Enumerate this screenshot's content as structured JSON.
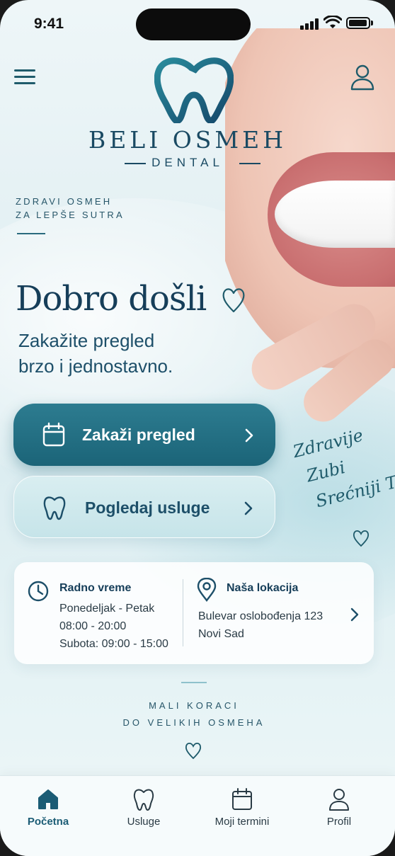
{
  "status_bar": {
    "time": "9:41"
  },
  "header": {
    "brand_name": "BELI OSMEH",
    "brand_sub": "DENTAL",
    "menu_icon": "hamburger-menu-icon",
    "profile_icon": "user-icon"
  },
  "tagline": {
    "line1": "ZDRAVI OSMEH",
    "line2": "ZA LEPŠE SUTRA"
  },
  "hero": {
    "title": "Dobro došli",
    "subtitle_line1": "Zakažite pregled",
    "subtitle_line2": "brzo i jednostavno."
  },
  "actions": {
    "primary": {
      "label": "Zakaži pregled",
      "icon": "calendar-icon"
    },
    "secondary": {
      "label": "Pogledaj usluge",
      "icon": "tooth-icon"
    }
  },
  "script_text": {
    "line1": "Zdravije",
    "line2": "Zubi",
    "line3": "Srećniji Ti"
  },
  "info": {
    "hours": {
      "title": "Radno vreme",
      "line1": "Ponedeljak - Petak",
      "line2": "08:00 - 20:00",
      "line3": "Subota: 09:00 - 15:00"
    },
    "location": {
      "title": "Naša lokacija",
      "line1": "Bulevar oslobođenja 123",
      "line2": "Novi Sad"
    }
  },
  "motto": {
    "line1": "MALI KORACI",
    "line2": "DO VELIKIH OSMEHA"
  },
  "tabs": [
    {
      "label": "Početna",
      "icon": "home-icon",
      "active": true
    },
    {
      "label": "Usluge",
      "icon": "tooth-icon",
      "active": false
    },
    {
      "label": "Moji termini",
      "icon": "calendar-icon",
      "active": false
    },
    {
      "label": "Profil",
      "icon": "user-icon",
      "active": false
    }
  ],
  "colors": {
    "primary": "#1b6478",
    "brand_dark": "#163e59",
    "secondary_button": "#c6e4e9"
  }
}
